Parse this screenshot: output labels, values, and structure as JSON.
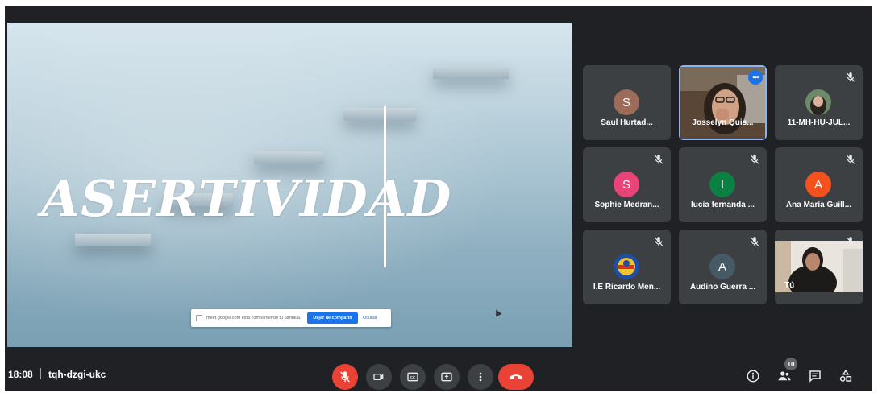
{
  "presentation": {
    "title": "ASERTIVIDAD",
    "share_message": "meet.google.com está compartiendo tu pantalla.",
    "stop_sharing_label": "Dejar de compartir",
    "hide_label": "Ocultar"
  },
  "participants": [
    {
      "name": "Saul Hurtad...",
      "initial": "S",
      "avatar_color": "#9c6b5a",
      "muted": false
    },
    {
      "name": "Josselyn Quis...",
      "initial": "",
      "avatar_color": "",
      "muted": false,
      "active": true
    },
    {
      "name": "11-MH-HU-JUL...",
      "initial": "",
      "avatar_color": "",
      "muted": true
    },
    {
      "name": "Sophie Medran...",
      "initial": "S",
      "avatar_color": "#e8447a",
      "muted": true
    },
    {
      "name": "lucia fernanda ...",
      "initial": "I",
      "avatar_color": "#0b8043",
      "muted": true
    },
    {
      "name": "Ana María Guill...",
      "initial": "A",
      "avatar_color": "#f4511e",
      "muted": true
    },
    {
      "name": "I.E Ricardo Men...",
      "initial": "",
      "avatar_color": "",
      "muted": true
    },
    {
      "name": "Audino Guerra ...",
      "initial": "A",
      "avatar_color": "#455a64",
      "muted": true
    },
    {
      "name": "Tú",
      "initial": "",
      "avatar_color": "",
      "muted": true
    }
  ],
  "bottom_bar": {
    "time": "18:08",
    "meeting_code": "tqh-dzgi-ukc",
    "participant_count": "10"
  },
  "colors": {
    "background": "#202124",
    "tile": "#3c4043",
    "danger": "#ea4335",
    "accent": "#1a73e8"
  }
}
